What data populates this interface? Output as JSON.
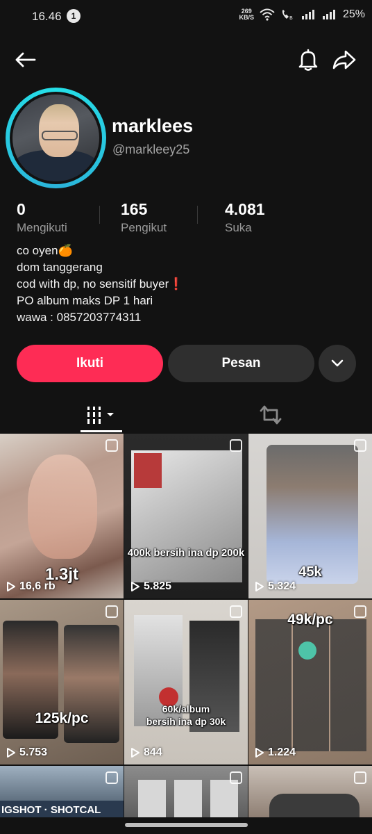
{
  "status_bar": {
    "time": "16.46",
    "notification_count": "1",
    "speed_value": "269",
    "speed_unit": "KB/S",
    "battery": "25%"
  },
  "header": {
    "back_icon": "arrow-left-icon",
    "bell_icon": "bell-icon",
    "share_icon": "share-icon"
  },
  "profile": {
    "display_name": "marklees",
    "handle": "@markleey25",
    "ring_color": "#25e0e8"
  },
  "stats": [
    {
      "value": "0",
      "label": "Mengikuti"
    },
    {
      "value": "165",
      "label": "Pengikut"
    },
    {
      "value": "4.081",
      "label": "Suka"
    }
  ],
  "bio": [
    "co oyen🍊",
    "dom tanggerang",
    "cod with dp, no sensitif buyer❗",
    "PO album maks DP 1 hari",
    "wawa : 0857203774311"
  ],
  "actions": {
    "follow_label": "Ikuti",
    "message_label": "Pesan",
    "follow_color": "#fe2c55"
  },
  "tabs": {
    "videos_icon": "grid-icon",
    "reposts_icon": "repost-icon"
  },
  "videos": [
    {
      "views": "16,6 rb",
      "caption": "1.3jt"
    },
    {
      "views": "5.825",
      "caption": "400k bersih ina dp 200k"
    },
    {
      "views": "5.324",
      "caption": "45k"
    },
    {
      "views": "5.753",
      "caption": "125k/pc"
    },
    {
      "views": "844",
      "caption_line1": "60k/album",
      "caption_line2": "bersih ina dp 30k"
    },
    {
      "views": "1.224",
      "caption": "49k/pc"
    },
    {
      "partial_text": "IGSHOT · SHOTCAL"
    }
  ]
}
